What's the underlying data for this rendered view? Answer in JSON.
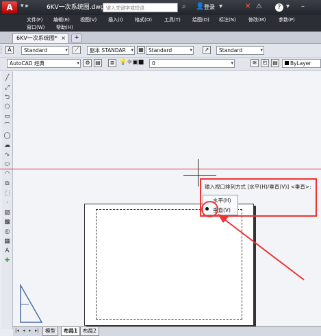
{
  "titlebar": {
    "app_letter": "A",
    "doc_title": "6KV一次系统图.dwg",
    "search_placeholder": "键入关键字或短语",
    "login": "登录",
    "help": "?"
  },
  "menu": {
    "row1": [
      "文件(F)",
      "编辑(E)",
      "视图(V)",
      "插入(I)",
      "格式(O)",
      "工具(T)",
      "绘图(D)",
      "标注(N)",
      "修改(M)",
      "参数(P)"
    ],
    "row2": [
      "窗口(W)",
      "帮助(H)"
    ]
  },
  "doc_tab": {
    "label": "6KV一次系统图*",
    "close": "×"
  },
  "toolbar1": {
    "text_style": "Standard",
    "dim_style": "副本 STANDAR",
    "table_style": "Standard",
    "mleader_style": "Standard"
  },
  "toolbar2": {
    "workspace": "AutoCAD 经典",
    "layer": "0",
    "color": "ByLayer"
  },
  "command": {
    "prompt": "输入视口排列方式 [水平(H)/垂直(V)] <垂直>:",
    "options": [
      "水平(H)",
      "垂直(V)"
    ],
    "selected": "垂直(V)"
  },
  "layout_tabs": [
    "模型",
    "布局1",
    "布局2"
  ],
  "colors": {
    "annotation_red": "#e33333",
    "title_bar": "#2b2e35"
  }
}
